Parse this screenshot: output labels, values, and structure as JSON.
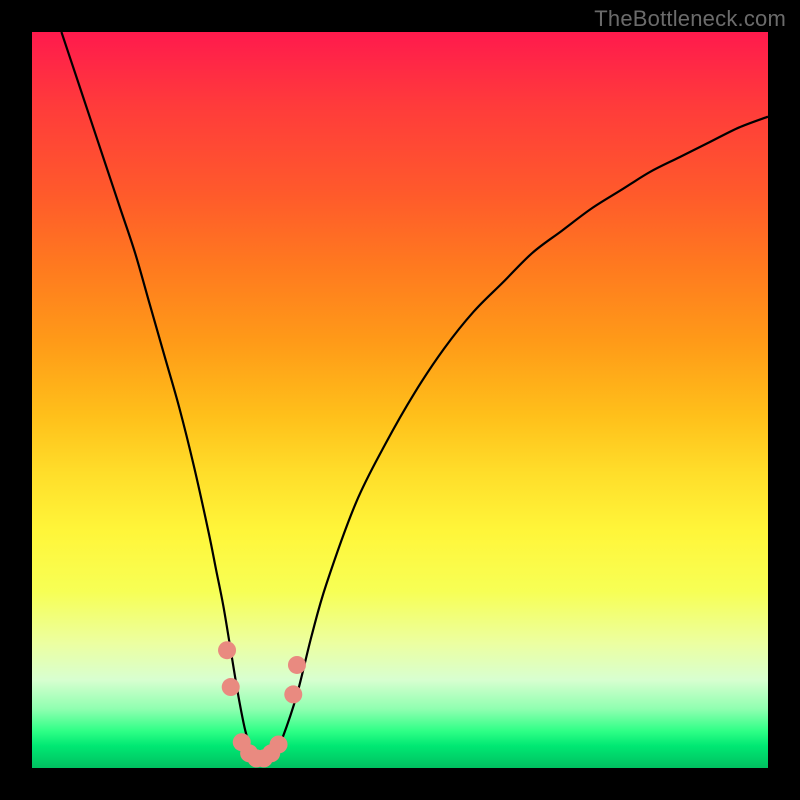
{
  "watermark": {
    "text": "TheBottleneck.com"
  },
  "colors": {
    "background": "#000000",
    "curve_stroke": "#000000",
    "marker_fill": "#e98a80",
    "marker_stroke": "#e98a80"
  },
  "chart_data": {
    "type": "line",
    "title": "",
    "xlabel": "",
    "ylabel": "",
    "xlim": [
      0,
      100
    ],
    "ylim": [
      0,
      100
    ],
    "grid": false,
    "legend": false,
    "series": [
      {
        "name": "bottleneck-curve",
        "x": [
          4,
          6,
          8,
          10,
          12,
          14,
          16,
          18,
          20,
          22,
          24,
          25,
          26,
          27,
          28,
          29,
          30,
          31,
          32,
          33,
          34,
          36,
          38,
          40,
          44,
          48,
          52,
          56,
          60,
          64,
          68,
          72,
          76,
          80,
          84,
          88,
          92,
          96,
          100
        ],
        "y": [
          100,
          94,
          88,
          82,
          76,
          70,
          63,
          56,
          49,
          41,
          32,
          27,
          22,
          16,
          10,
          5,
          2,
          1,
          1,
          2,
          4,
          10,
          18,
          25,
          36,
          44,
          51,
          57,
          62,
          66,
          70,
          73,
          76,
          78.5,
          81,
          83,
          85,
          87,
          88.5
        ]
      }
    ],
    "markers": [
      {
        "x": 26.5,
        "y": 16
      },
      {
        "x": 27.0,
        "y": 11
      },
      {
        "x": 28.5,
        "y": 3.5
      },
      {
        "x": 29.5,
        "y": 2.0
      },
      {
        "x": 30.5,
        "y": 1.3
      },
      {
        "x": 31.5,
        "y": 1.3
      },
      {
        "x": 32.5,
        "y": 2.0
      },
      {
        "x": 33.5,
        "y": 3.2
      },
      {
        "x": 35.5,
        "y": 10
      },
      {
        "x": 36.0,
        "y": 14
      }
    ]
  }
}
